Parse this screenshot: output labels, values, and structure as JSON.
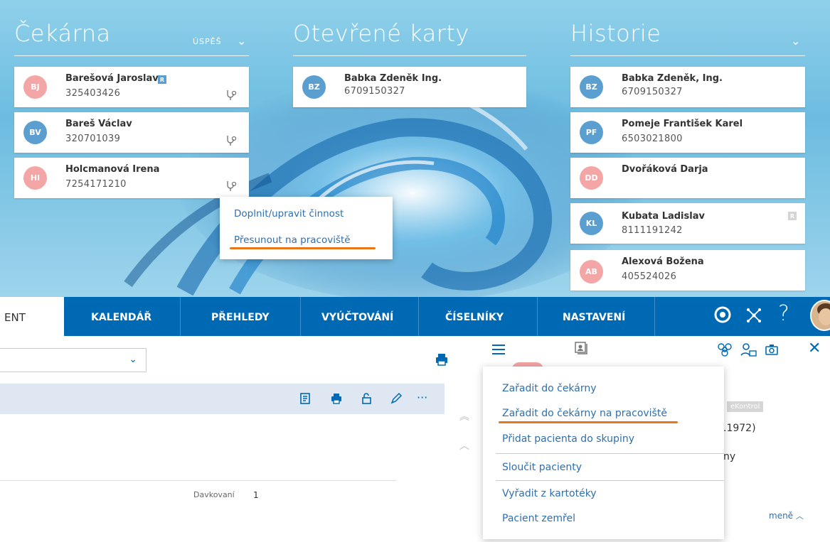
{
  "waiting_room": {
    "title": "Čekárna",
    "filter": "ÚSPĚŠ",
    "patients": [
      {
        "initials": "BJ",
        "name": "Barešová Jaroslava",
        "id": "325403426",
        "badge": "R"
      },
      {
        "initials": "BV",
        "name": "Bareš Václav",
        "id": "320701039"
      },
      {
        "initials": "HI",
        "name": "Holcmanová Irena",
        "id": "7254171210"
      }
    ]
  },
  "open_cards": {
    "title": "Otevřené karty",
    "patients": [
      {
        "initials": "BZ",
        "name": "Babka Zdeněk Ing.",
        "id": "6709150327"
      }
    ]
  },
  "history": {
    "title": "Historie",
    "patients": [
      {
        "initials": "BZ",
        "name": "Babka Zdeněk, Ing.",
        "id": "6709150327"
      },
      {
        "initials": "PF",
        "name": "Pomeje František Karel",
        "id": "6503021800"
      },
      {
        "initials": "DD",
        "name": "Dvořáková Darja",
        "id": ""
      },
      {
        "initials": "KL",
        "name": "Kubata Ladislav",
        "id": "8111191242",
        "badge": "R"
      },
      {
        "initials": "AB",
        "name": "Alexová Božena",
        "id": "405524026"
      }
    ]
  },
  "context_menu_top": {
    "items": [
      "Doplnit/upravit činnost",
      "Přesunout na pracoviště"
    ]
  },
  "nav": {
    "active_tab": "ENT",
    "items": [
      "KALENDÁŘ",
      "PŘEHLEDY",
      "VYÚČTOVÁNÍ",
      "ČÍSELNÍKY",
      "NASTAVENÍ"
    ],
    "help": "?"
  },
  "content": {
    "davkovani_label": "Davkovaní",
    "davkovani_value": "1",
    "ekontrol": "eKontrol",
    "date_fragment": ".1972)",
    "text_fragment": "ny",
    "less_link": "meně"
  },
  "context_menu_bottom": {
    "items": [
      "Zařadit do čekárny",
      "Zařadit do čekárny na pracoviště",
      "Přidat pacienta do skupiny",
      "Sloučit pacienty",
      "Vyřadit z kartotéky",
      "Pacient zemřel"
    ]
  },
  "colors": {
    "nav_blue": "#0069b4",
    "link_blue": "#2f6fad",
    "highlight_orange": "#e8761a",
    "avatar_pink": "#f4a5a5",
    "avatar_blue": "#5b9fd1"
  }
}
